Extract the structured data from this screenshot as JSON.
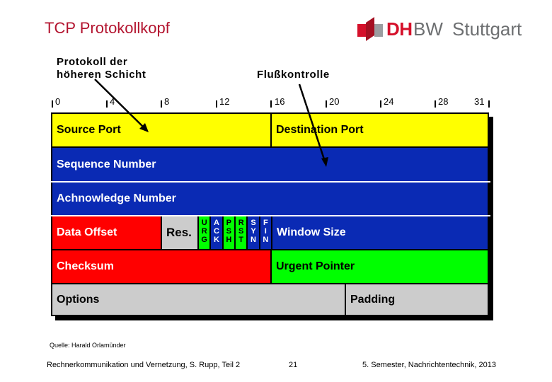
{
  "slide": {
    "title": "TCP Protokollkopf",
    "logo": {
      "mark": "DH",
      "mark2": "BW",
      "city": "Stuttgart"
    },
    "annotations": {
      "upper_layer_line1": "Protokoll der",
      "upper_layer_line2": "höheren Schicht",
      "flow_control": "Flußkontrolle"
    },
    "bit_ruler": [
      "0",
      "4",
      "8",
      "12",
      "16",
      "20",
      "24",
      "28",
      "31"
    ],
    "header_fields": {
      "source_port": "Source Port",
      "destination_port": "Destination Port",
      "sequence_number": "Sequence Number",
      "acknowledge_number": "Achnowledge Number",
      "data_offset": "Data Offset",
      "reserved": "Res.",
      "flags": [
        {
          "name": "URG",
          "letters": [
            "U",
            "R",
            "G"
          ],
          "color": "#00ff00"
        },
        {
          "name": "ACK",
          "letters": [
            "A",
            "C",
            "K"
          ],
          "color": "#0a2ab4"
        },
        {
          "name": "PSH",
          "letters": [
            "P",
            "S",
            "H"
          ],
          "color": "#00ff00"
        },
        {
          "name": "RST",
          "letters": [
            "R",
            "S",
            "T"
          ],
          "color": "#00ff00"
        },
        {
          "name": "SYN",
          "letters": [
            "S",
            "Y",
            "N"
          ],
          "color": "#0a2ab4"
        },
        {
          "name": "FIN",
          "letters": [
            "F",
            "I",
            "N"
          ],
          "color": "#0a2ab4"
        }
      ],
      "window_size": "Window Size",
      "checksum": "Checksum",
      "urgent_pointer": "Urgent Pointer",
      "options": "Options",
      "padding": "Padding"
    },
    "colors": {
      "title": "#b3142f",
      "ports": "#ffff00",
      "numbers": "#0a2ab4",
      "offset_checksum": "#ff0000",
      "urgent": "#00ff00",
      "options": "#cccccc"
    },
    "source_note": "Quelle: Harald Orlamünder",
    "footer": {
      "course": "Rechnerkommunikation und Vernetzung, S. Rupp, Teil 2",
      "page": "21",
      "semester": "5. Semester, Nachrichtentechnik, 2013"
    }
  }
}
